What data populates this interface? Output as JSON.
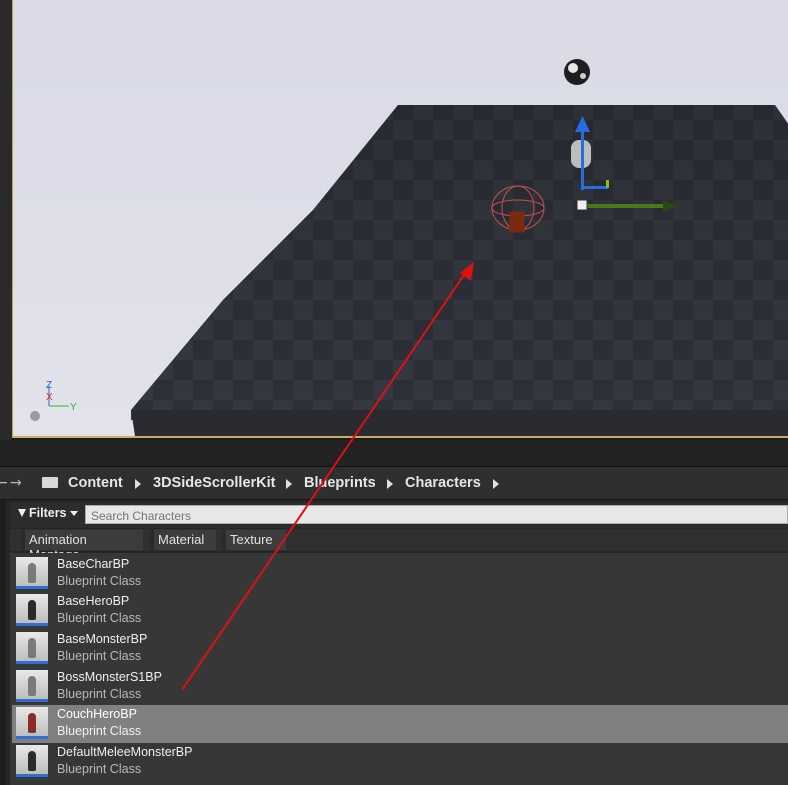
{
  "content_browser": {
    "path": [
      "Content",
      "3DSideScrollerKit",
      "Blueprints",
      "Characters"
    ],
    "filters_label": "Filters",
    "search_placeholder": "Search Characters",
    "filter_chips": [
      "Animation Montage",
      "Material",
      "Texture"
    ],
    "assets": [
      {
        "name": "BaseCharBP",
        "type": "Blueprint Class",
        "selected": false
      },
      {
        "name": "BaseHeroBP",
        "type": "Blueprint Class",
        "selected": false
      },
      {
        "name": "BaseMonsterBP",
        "type": "Blueprint Class",
        "selected": false
      },
      {
        "name": "BossMonsterS1BP",
        "type": "Blueprint Class",
        "selected": false
      },
      {
        "name": "CouchHeroBP",
        "type": "Blueprint Class",
        "selected": true
      },
      {
        "name": "DefaultMeleeMonsterBP",
        "type": "Blueprint Class",
        "selected": false
      }
    ]
  },
  "viewport": {
    "axis_labels": {
      "z": "Z",
      "x": "X",
      "y": "Y"
    }
  },
  "colors": {
    "accent_selection": "#808080",
    "asset_underline": "#2d6fd6",
    "annotation_arrow": "#e01010",
    "viewport_border": "#c9b060"
  },
  "icons": [
    "folder-icon",
    "back-arrow-icon",
    "forward-arrow-icon",
    "filter-funnel-icon",
    "dropdown-caret-icon",
    "path-separator-icon",
    "reflection-sphere-icon",
    "axis-gizmo-icon",
    "help-icon"
  ]
}
